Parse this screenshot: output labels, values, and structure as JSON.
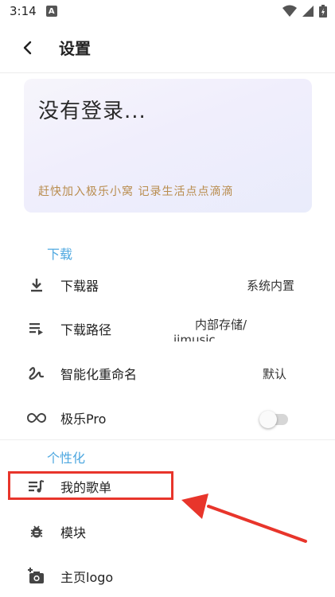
{
  "status_bar": {
    "time": "3:14",
    "notification_letter": "A"
  },
  "app_bar": {
    "title": "设置"
  },
  "login_card": {
    "title": "没有登录...",
    "subtitle": "赶快加入极乐小窝 记录生活点点滴滴"
  },
  "sections": {
    "download": {
      "header": "下载",
      "items": [
        {
          "label": "下载器",
          "value": "系统内置",
          "icon": "download-icon"
        },
        {
          "label": "下载路径",
          "value_line1": "内部存储/",
          "value_line2": "iimusic",
          "icon": "queue-icon"
        },
        {
          "label": "智能化重命名",
          "value": "默认",
          "icon": "gesture-icon"
        },
        {
          "label": "极乐Pro",
          "toggle_on": false,
          "icon": "infinity-icon"
        }
      ]
    },
    "personalize": {
      "header": "个性化",
      "items": [
        {
          "label": "我的歌单",
          "icon": "playlist-icon"
        },
        {
          "label": "模块",
          "icon": "bug-icon"
        },
        {
          "label": "主页logo",
          "icon": "add-photo-icon"
        }
      ]
    }
  },
  "colors": {
    "accent": "#4fa8e0",
    "highlight": "#e8352b",
    "subtitle": "#b98d4f"
  }
}
